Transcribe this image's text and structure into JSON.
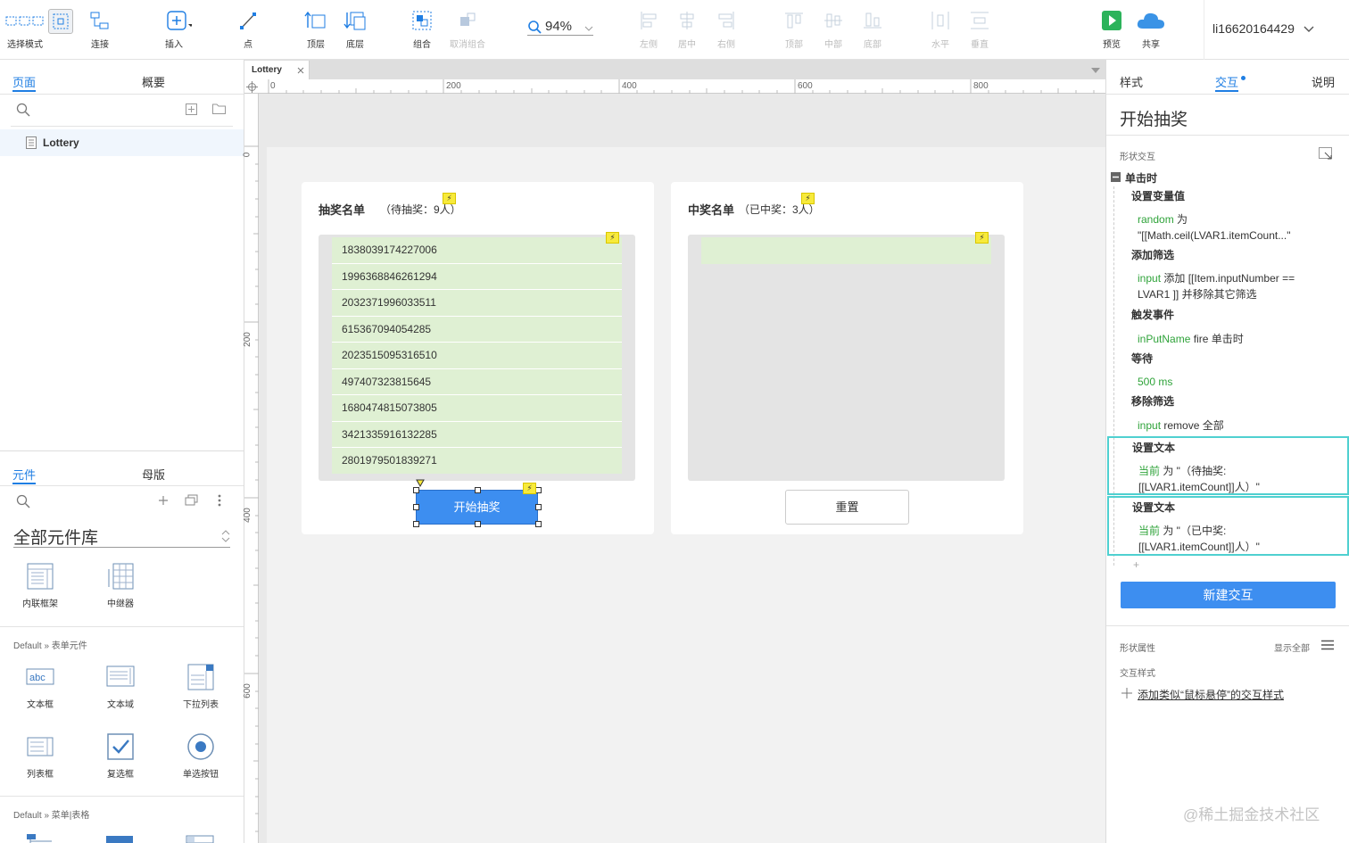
{
  "toolbar": {
    "select_mode": "选择模式",
    "connect": "连接",
    "insert": "插入",
    "point": "点",
    "top_layer": "顶层",
    "bottom_layer": "底层",
    "group": "组合",
    "ungroup": "取消组合",
    "zoom": "94%",
    "align_left": "左侧",
    "align_center": "居中",
    "align_right": "右侧",
    "align_top": "顶部",
    "align_middle": "中部",
    "align_bottom": "底部",
    "distribute_h": "水平",
    "distribute_v": "垂直",
    "preview": "预览",
    "share": "共享",
    "user": "li16620164429"
  },
  "pages_panel": {
    "tab_pages": "页面",
    "tab_outline": "概要",
    "page_name": "Lottery"
  },
  "library_panel": {
    "tab_widgets": "元件",
    "tab_masters": "母版",
    "library_title": "全部元件库",
    "top_items": [
      "内联框架",
      "中继器"
    ],
    "section_form": "Default » 表单元件",
    "form_items": [
      "文本框",
      "文本域",
      "下拉列表",
      "列表框",
      "复选框",
      "单选按钮"
    ],
    "section_menu": "Default » 菜单|表格"
  },
  "canvas": {
    "tab_name": "Lottery",
    "ruler_h": [
      "0",
      "200",
      "400",
      "600",
      "800"
    ],
    "ruler_v": [
      "0",
      "200",
      "400",
      "600"
    ],
    "left_card": {
      "title": "抽奖名单",
      "subtitle": "（待抽奖：9人）",
      "rows": [
        "1838039174227006",
        "1996368846261294",
        "2032371996033511",
        "615367094054285",
        "2023515095316510",
        "497407323815645",
        "1680474815073805",
        "3421335916132285",
        "2801979501839271"
      ],
      "start_button": "开始抽奖"
    },
    "right_card": {
      "title": "中奖名单",
      "subtitle": "（已中奖：3人）",
      "reset_button": "重置"
    }
  },
  "inspector": {
    "tab_style": "样式",
    "tab_interaction": "交互",
    "tab_notes": "说明",
    "element_name": "开始抽奖",
    "section_shape_interaction": "形状交互",
    "event": "单击时",
    "actions": [
      {
        "title": "设置变量值",
        "target": "random",
        "rest": " 为",
        "line2": "\"[[Math.ceil(LVAR1.itemCount...\""
      },
      {
        "title": "添加筛选",
        "target": "input",
        "rest": " 添加 [[Item.inputNumber ==",
        "line2": "LVAR1 ]] 并移除其它筛选"
      },
      {
        "title": "触发事件",
        "target": "inPutName",
        "rest": " fire 单击时",
        "line2": ""
      },
      {
        "title": "等待",
        "target": "500 ms",
        "rest": "",
        "line2": ""
      },
      {
        "title": "移除筛选",
        "target": "input",
        "rest": " remove 全部",
        "line2": ""
      },
      {
        "title": "设置文本",
        "target": "当前",
        "rest": " 为 \"（待抽奖:",
        "line2": "[[LVAR1.itemCount]]人）\""
      },
      {
        "title": "设置文本",
        "target": "当前",
        "rest": " 为 \"（已中奖:",
        "line2": "[[LVAR1.itemCount]]人）\""
      }
    ],
    "add_symbol": "+",
    "new_interaction": "新建交互",
    "section_shape_props": "形状属性",
    "show_all": "显示全部",
    "section_interaction_style": "交互样式",
    "add_style_link": "添加类似“鼠标悬停”的交互样式"
  },
  "watermark": "@稀土掘金技术社区",
  "colors": {
    "accent": "#1f7ee3",
    "button": "#3d8ef0",
    "row_green": "#dff0d3",
    "bolt": "#f7ea3b",
    "action_green": "#2fa33a",
    "highlight": "#4fd0d0"
  }
}
